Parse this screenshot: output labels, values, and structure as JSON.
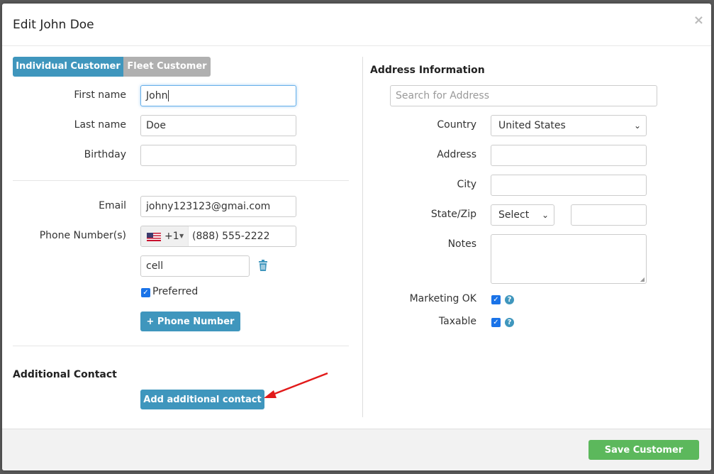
{
  "modal": {
    "title": "Edit John Doe",
    "close_glyph": "×"
  },
  "tabs": {
    "individual": "Individual Customer",
    "fleet": "Fleet Customer"
  },
  "customer": {
    "first_name_label": "First name",
    "first_name_value": "John",
    "last_name_label": "Last name",
    "last_name_value": "Doe",
    "birthday_label": "Birthday",
    "birthday_value": ""
  },
  "contact": {
    "email_label": "Email",
    "email_value": "johny123123@gmai.com",
    "phone_label": "Phone Number(s)",
    "phone_country_code": "+1",
    "phone_value": "(888) 555-2222",
    "phone_type_value": "cell",
    "preferred_label": "Preferred",
    "add_phone_label": "+  Phone Number"
  },
  "additional": {
    "title": "Additional Contact",
    "add_button": "Add additional contact"
  },
  "address": {
    "title": "Address Information",
    "search_placeholder": "Search for Address",
    "country_label": "Country",
    "country_value": "United States",
    "address_label": "Address",
    "city_label": "City",
    "state_zip_label": "State/Zip",
    "state_value": "Select",
    "notes_label": "Notes",
    "marketing_label": "Marketing OK",
    "taxable_label": "Taxable"
  },
  "footer": {
    "save_label": "Save Customer"
  },
  "colors": {
    "primary": "#3f96bd",
    "success": "#5cb85c",
    "inactive": "#b0b0b0",
    "arrow": "#e21a1a"
  },
  "icons": [
    "close-icon",
    "us-flag-icon",
    "trash-icon",
    "checkbox-checked-icon",
    "help-icon",
    "chevron-down-icon",
    "plus-icon",
    "annotation-arrow"
  ]
}
